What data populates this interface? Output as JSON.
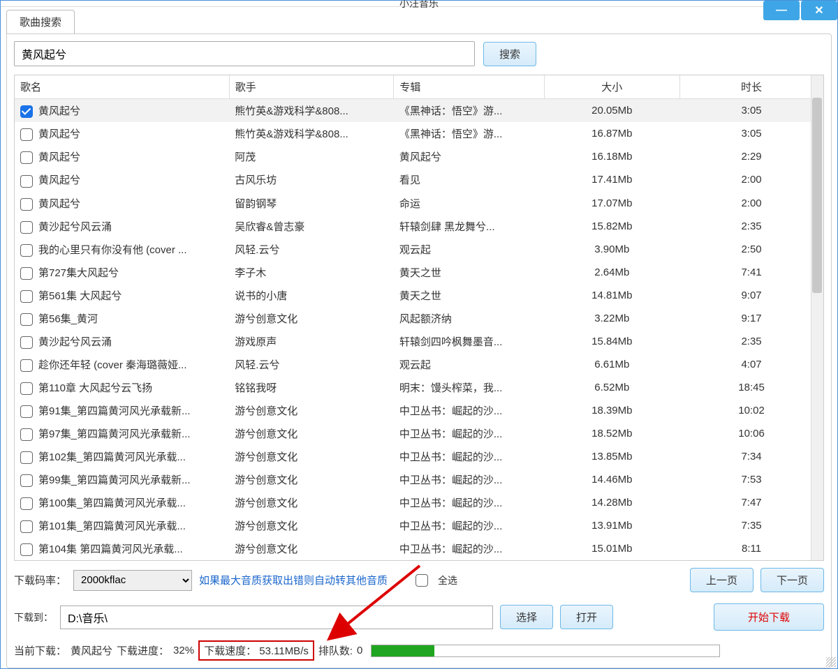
{
  "window": {
    "title": "小汪音乐"
  },
  "tabs": {
    "search": "歌曲搜索"
  },
  "search": {
    "value": "黄风起兮",
    "button": "搜索"
  },
  "columns": {
    "name": "歌名",
    "artist": "歌手",
    "album": "专辑",
    "size": "大小",
    "duration": "时长"
  },
  "rows": [
    {
      "checked": true,
      "name": "黄风起兮",
      "artist": "熊竹英&游戏科学&808...",
      "album": "《黑神话：悟空》游...",
      "size": "20.05Mb",
      "dur": "3:05"
    },
    {
      "checked": false,
      "name": "黄风起兮",
      "artist": "熊竹英&游戏科学&808...",
      "album": "《黑神话：悟空》游...",
      "size": "16.87Mb",
      "dur": "3:05"
    },
    {
      "checked": false,
      "name": "黄风起兮",
      "artist": "阿茂",
      "album": "黄风起兮",
      "size": "16.18Mb",
      "dur": "2:29"
    },
    {
      "checked": false,
      "name": "黄风起兮",
      "artist": "古风乐坊",
      "album": "看见",
      "size": "17.41Mb",
      "dur": "2:00"
    },
    {
      "checked": false,
      "name": "黄风起兮",
      "artist": "留韵钢琴",
      "album": "命运",
      "size": "17.07Mb",
      "dur": "2:00"
    },
    {
      "checked": false,
      "name": "黄沙起兮风云涌",
      "artist": "吴欣睿&曾志豪",
      "album": "轩辕剑肆 黑龙舞兮...",
      "size": "15.82Mb",
      "dur": "2:35"
    },
    {
      "checked": false,
      "name": "我的心里只有你没有他 (cover ...",
      "artist": "风轻.云兮",
      "album": "观云起",
      "size": "3.90Mb",
      "dur": "2:50"
    },
    {
      "checked": false,
      "name": "第727集大风起兮",
      "artist": "李子木",
      "album": "黄天之世",
      "size": "2.64Mb",
      "dur": "7:41"
    },
    {
      "checked": false,
      "name": "第561集 大风起兮",
      "artist": "说书的小唐",
      "album": "黄天之世",
      "size": "14.81Mb",
      "dur": "9:07"
    },
    {
      "checked": false,
      "name": "第56集_黄河",
      "artist": "游兮创意文化",
      "album": "风起额济纳",
      "size": "3.22Mb",
      "dur": "9:17"
    },
    {
      "checked": false,
      "name": "黄沙起兮风云涌",
      "artist": "游戏原声",
      "album": "轩辕剑四吟枫舞墨音...",
      "size": "15.84Mb",
      "dur": "2:35"
    },
    {
      "checked": false,
      "name": "趁你还年轻 (cover 秦海璐薇娅...",
      "artist": "风轻.云兮",
      "album": "观云起",
      "size": "6.61Mb",
      "dur": "4:07"
    },
    {
      "checked": false,
      "name": "第110章 大风起兮云飞扬",
      "artist": "铭铭我呀",
      "album": "明末：馒头榨菜，我...",
      "size": "6.52Mb",
      "dur": "18:45"
    },
    {
      "checked": false,
      "name": "第91集_第四篇黄河风光承载新...",
      "artist": "游兮创意文化",
      "album": "中卫丛书：崛起的沙...",
      "size": "18.39Mb",
      "dur": "10:02"
    },
    {
      "checked": false,
      "name": "第97集_第四篇黄河风光承载新...",
      "artist": "游兮创意文化",
      "album": "中卫丛书：崛起的沙...",
      "size": "18.52Mb",
      "dur": "10:06"
    },
    {
      "checked": false,
      "name": "第102集_第四篇黄河风光承载...",
      "artist": "游兮创意文化",
      "album": "中卫丛书：崛起的沙...",
      "size": "13.85Mb",
      "dur": "7:34"
    },
    {
      "checked": false,
      "name": "第99集_第四篇黄河风光承载新...",
      "artist": "游兮创意文化",
      "album": "中卫丛书：崛起的沙...",
      "size": "14.46Mb",
      "dur": "7:53"
    },
    {
      "checked": false,
      "name": "第100集_第四篇黄河风光承载...",
      "artist": "游兮创意文化",
      "album": "中卫丛书：崛起的沙...",
      "size": "14.28Mb",
      "dur": "7:47"
    },
    {
      "checked": false,
      "name": "第101集_第四篇黄河风光承载...",
      "artist": "游兮创意文化",
      "album": "中卫丛书：崛起的沙...",
      "size": "13.91Mb",
      "dur": "7:35"
    },
    {
      "checked": false,
      "name": "第104集 第四篇黄河风光承载...",
      "artist": "游兮创意文化",
      "album": "中卫丛书：崛起的沙...",
      "size": "15.01Mb",
      "dur": "8:11"
    }
  ],
  "bitrate": {
    "label": "下载码率：",
    "value": "2000kflac",
    "hint": "如果最大音质获取出错则自动转其他音质",
    "select_all": "全选",
    "prev": "上一页",
    "next": "下一页"
  },
  "download": {
    "label": "下载到：",
    "path": "D:\\音乐\\",
    "choose": "选择",
    "open": "打开",
    "start": "开始下载"
  },
  "status": {
    "current_label": "当前下载：",
    "current_value": "黄风起兮",
    "progress_label": "下载进度：",
    "progress_value": "32%",
    "speed_label": "下载速度：",
    "speed_value": "53.11MB/s",
    "queue_label": "排队数:",
    "queue_value": "0"
  }
}
